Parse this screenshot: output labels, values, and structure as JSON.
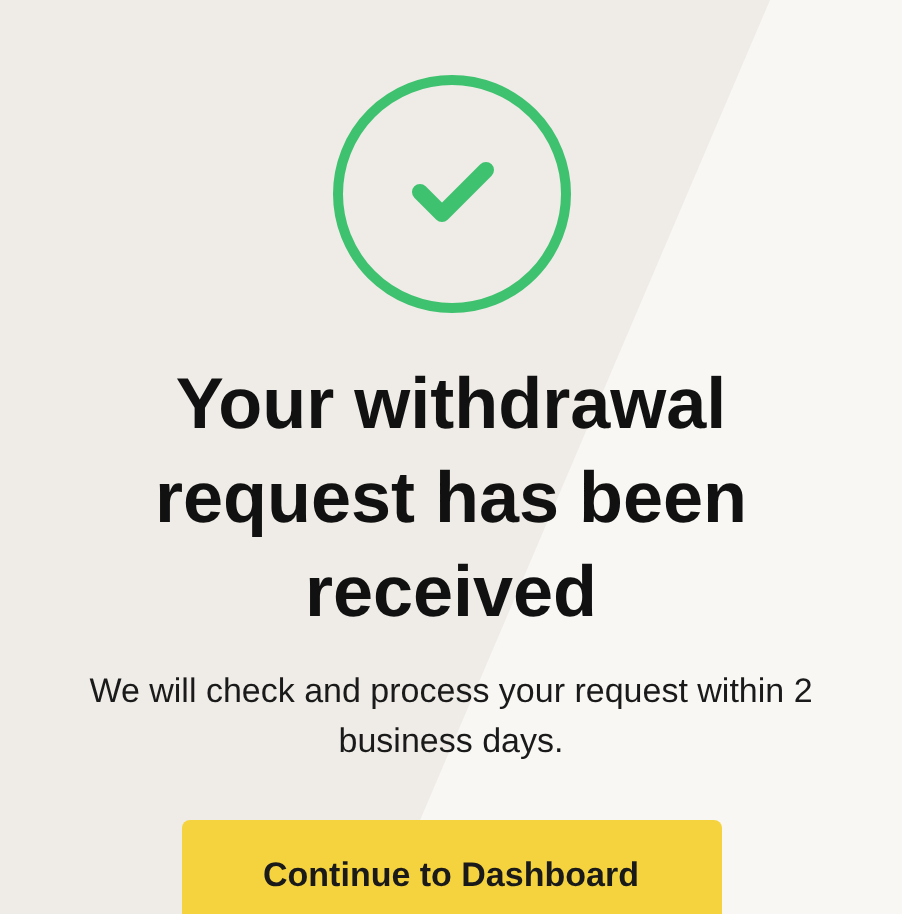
{
  "title": "Your withdrawal request has been received",
  "message": "We will check and process your request within 2 business days.",
  "button": {
    "label": "Continue to Dashboard"
  }
}
